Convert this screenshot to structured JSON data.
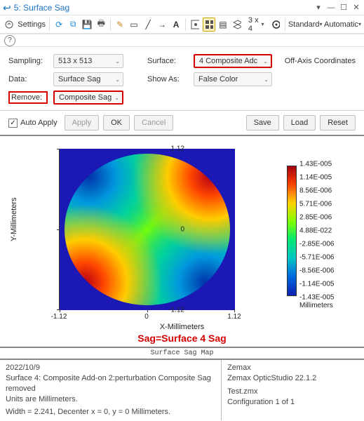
{
  "window": {
    "title": "5: Surface Sag"
  },
  "toolbar": {
    "settings": "Settings",
    "grid": "3 x 4",
    "standard": "Standard",
    "automatic": "Automatic"
  },
  "form": {
    "sampling_label": "Sampling:",
    "sampling_value": "513 x 513",
    "data_label": "Data:",
    "data_value": "Surface Sag",
    "remove_label": "Remove:",
    "remove_value": "Composite Sag",
    "surface_label": "Surface:",
    "surface_value": "4 Composite Adc",
    "showas_label": "Show As:",
    "showas_value": "False Color",
    "offaxis": "Off-Axis Coordinates"
  },
  "actions": {
    "auto_apply": "Auto Apply",
    "apply": "Apply",
    "ok": "OK",
    "cancel": "Cancel",
    "save": "Save",
    "load": "Load",
    "reset": "Reset"
  },
  "chart_data": {
    "type": "heatmap",
    "title": "",
    "xlabel": "X-Millimeters",
    "ylabel": "Y-Millimeters",
    "xlim": [
      -1.12,
      1.12
    ],
    "ylim": [
      -1.12,
      1.12
    ],
    "xticks": [
      -1.12,
      0,
      1.12
    ],
    "yticks": [
      -1.12,
      0,
      1.12
    ],
    "colorbar_unit": "Millimeters",
    "colorbar_ticks": [
      "1.43E-005",
      "1.14E-005",
      "8.56E-006",
      "5.71E-006",
      "2.85E-006",
      "4.88E-022",
      "-2.85E-006",
      "-5.71E-006",
      "-8.56E-006",
      "-1.14E-005",
      "-1.43E-005"
    ],
    "annotation": "Sag=Surface 4 Sag"
  },
  "footer": {
    "title": "Surface Sag Map",
    "left1": "2022/10/9",
    "left2": "Surface 4: Composite Add-on 2:perturbation Composite Sag removed",
    "left3": "Units are Millimeters.",
    "left4": "Width = 2.241, Decenter x = 0, y = 0 Millimeters.",
    "right1": "Zemax",
    "right2": "Zemax OpticStudio 22.1.2",
    "right3": "Test.zmx",
    "right4": "Configuration 1 of 1"
  }
}
